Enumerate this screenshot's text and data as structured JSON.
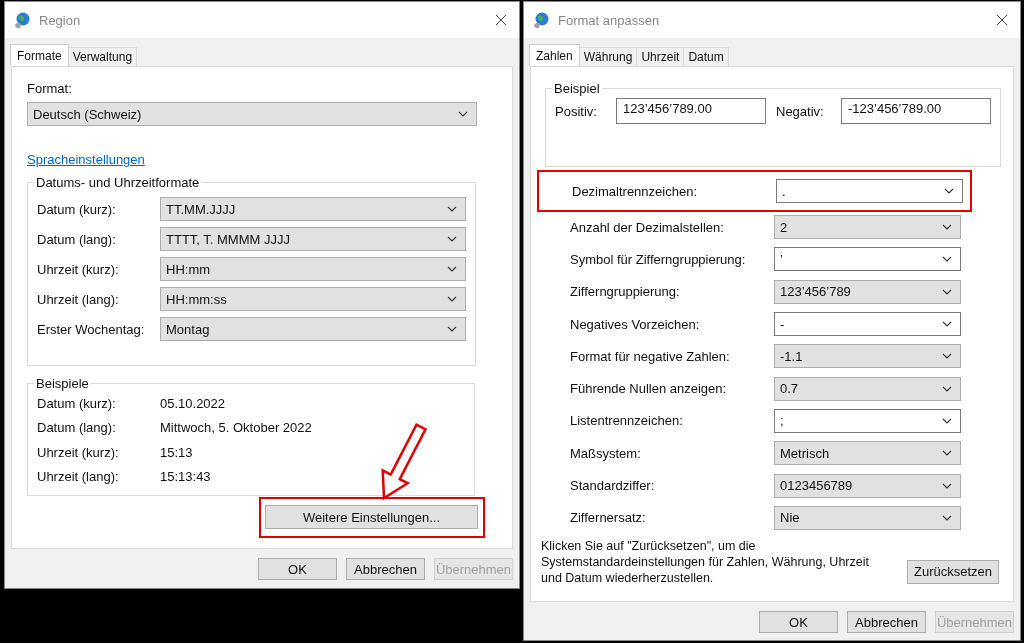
{
  "region_dialog": {
    "title": "Region",
    "tabs": [
      {
        "label": "Formate",
        "selected": true
      },
      {
        "label": "Verwaltung",
        "selected": false
      }
    ],
    "format": {
      "label": "Format:",
      "value": "Deutsch (Schweiz)",
      "kind": "list"
    },
    "link": "Spracheinstellungen",
    "date_time_formats": {
      "title": "Datums- und Uhrzeitformate",
      "rows": [
        {
          "label": "Datum (kurz):",
          "value": "TT.MM.JJJJ",
          "kind": "list"
        },
        {
          "label": "Datum (lang):",
          "value": "TTTT, T. MMMM JJJJ",
          "kind": "list"
        },
        {
          "label": "Uhrzeit (kurz):",
          "value": "HH:mm",
          "kind": "list"
        },
        {
          "label": "Uhrzeit (lang):",
          "value": "HH:mm:ss",
          "kind": "list"
        },
        {
          "label": "Erster Wochentag:",
          "value": "Montag",
          "kind": "list"
        }
      ]
    },
    "examples": {
      "title": "Beispiele",
      "rows": [
        {
          "label": "Datum (kurz):",
          "value": "05.10.2022"
        },
        {
          "label": "Datum (lang):",
          "value": "Mittwoch, 5. Oktober 2022"
        },
        {
          "label": "Uhrzeit (kurz):",
          "value": "15:13"
        },
        {
          "label": "Uhrzeit (lang):",
          "value": "15:13:43"
        }
      ]
    },
    "more_button": {
      "label": "Weitere Einstellungen...",
      "highlighted": true,
      "arrow": true
    },
    "buttons": [
      {
        "label": "OK",
        "disabled": false
      },
      {
        "label": "Abbrechen",
        "disabled": false
      },
      {
        "label": "Übernehmen",
        "disabled": true
      }
    ]
  },
  "format_dialog": {
    "title": "Format anpassen",
    "tabs": [
      {
        "label": "Zahlen",
        "selected": true
      },
      {
        "label": "Währung",
        "selected": false
      },
      {
        "label": "Uhrzeit",
        "selected": false
      },
      {
        "label": "Datum",
        "selected": false
      }
    ],
    "example": {
      "title": "Beispiel",
      "positive": {
        "label": "Positiv:",
        "value": "123’456’789.00"
      },
      "negative": {
        "label": "Negativ:",
        "value": "-123’456’789.00"
      }
    },
    "rows": [
      {
        "label": "Dezimaltrennzeichen:",
        "value": ".",
        "kind": "combo",
        "highlighted": true
      },
      {
        "label": "Anzahl der Dezimalstellen:",
        "value": "2",
        "kind": "list",
        "highlighted": false
      },
      {
        "label": "Symbol für Zifferngruppierung:",
        "value": "’",
        "kind": "combo",
        "highlighted": false
      },
      {
        "label": "Zifferngruppierung:",
        "value": "123’456’789",
        "kind": "list",
        "highlighted": false
      },
      {
        "label": "Negatives Vorzeichen:",
        "value": "-",
        "kind": "combo",
        "highlighted": false
      },
      {
        "label": "Format für negative Zahlen:",
        "value": "-1.1",
        "kind": "list",
        "highlighted": false
      },
      {
        "label": "Führende Nullen anzeigen:",
        "value": "0.7",
        "kind": "list",
        "highlighted": false
      },
      {
        "label": "Listentrennzeichen:",
        "value": ";",
        "kind": "combo",
        "highlighted": false
      },
      {
        "label": "Maßsystem:",
        "value": "Metrisch",
        "kind": "list",
        "highlighted": false
      },
      {
        "label": "Standardziffer:",
        "value": "0123456789",
        "kind": "list",
        "highlighted": false
      },
      {
        "label": "Ziffernersatz:",
        "value": "Nie",
        "kind": "list",
        "highlighted": false
      }
    ],
    "reset_note": "Klicken Sie auf \"Zurücksetzen\", um die Systemstandardeinstellungen für Zahlen, Währung, Uhrzeit und Datum wiederherzustellen.",
    "reset_button": {
      "label": "Zurücksetzen"
    },
    "buttons": [
      {
        "label": "OK",
        "disabled": false
      },
      {
        "label": "Abbrechen",
        "disabled": false
      },
      {
        "label": "Übernehmen",
        "disabled": true
      }
    ]
  }
}
